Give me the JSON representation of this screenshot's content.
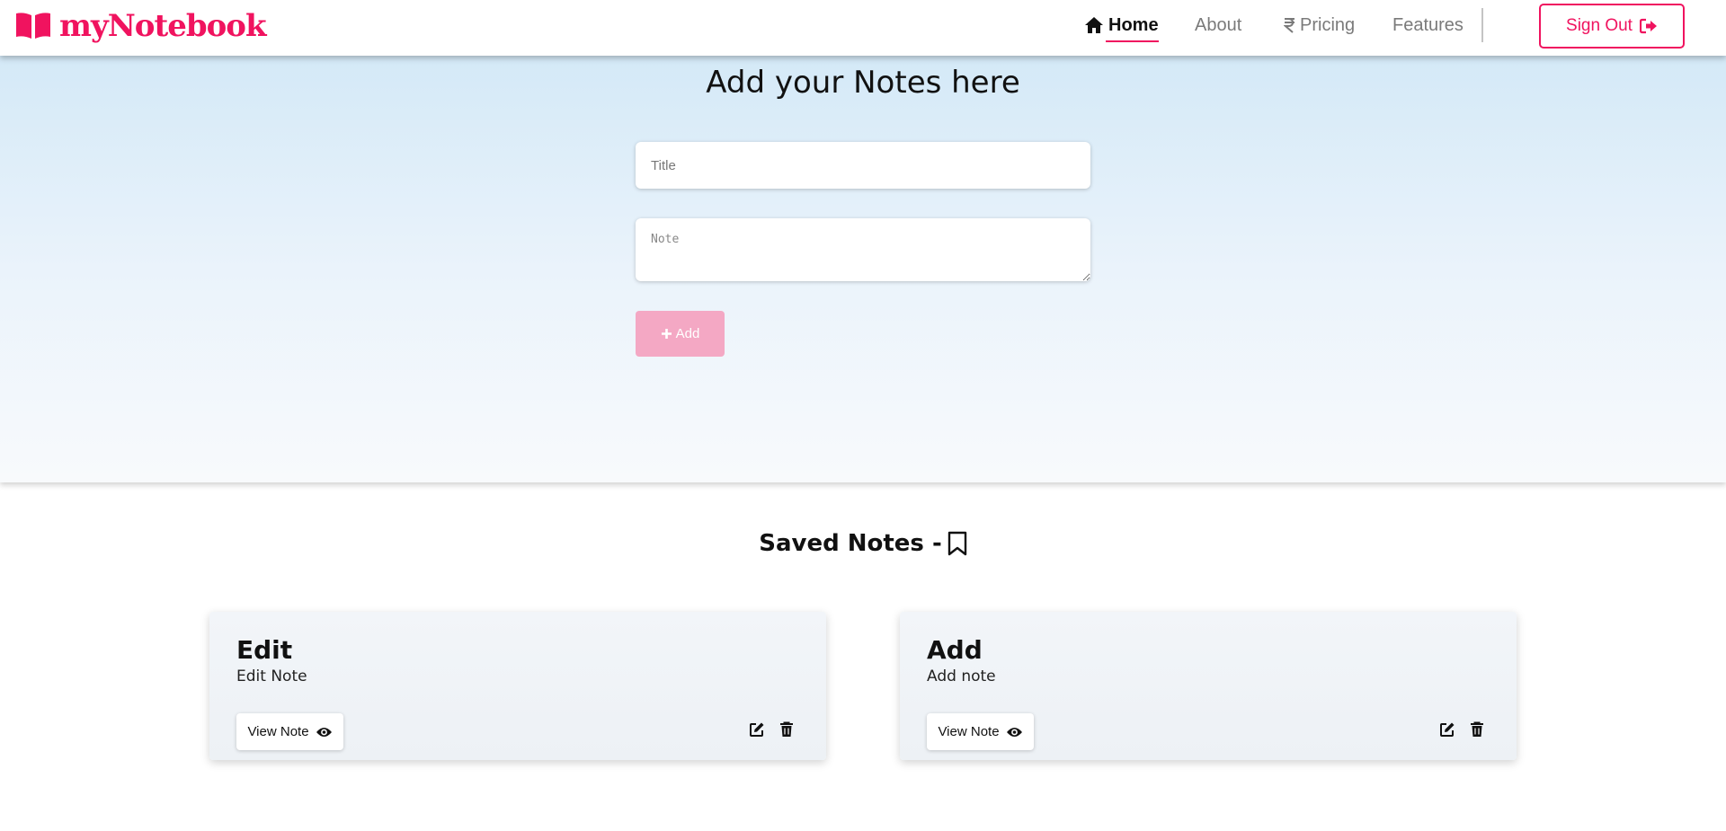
{
  "navbar": {
    "brand": "myNotebook",
    "links": {
      "home": "Home",
      "about": "About",
      "pricing": "Pricing",
      "features": "Features"
    },
    "signout_label": "Sign Out"
  },
  "hero": {
    "title": "Add your Notes here",
    "title_placeholder": "Title",
    "note_placeholder": "Note",
    "add_label": "Add"
  },
  "saved": {
    "heading": "Saved Notes -",
    "notes": [
      {
        "title": "Edit",
        "description": "Edit Note",
        "view_label": "View Note"
      },
      {
        "title": "Add",
        "description": "Add note",
        "view_label": "View Note"
      }
    ]
  },
  "colors": {
    "accent": "#f0135f",
    "add_button": "#f4a8c4"
  },
  "icons": [
    "book-icon",
    "home-icon",
    "rupee-icon",
    "sign-out-icon",
    "plus-icon",
    "bookmark-icon",
    "eye-icon",
    "edit-icon",
    "trash-icon"
  ]
}
